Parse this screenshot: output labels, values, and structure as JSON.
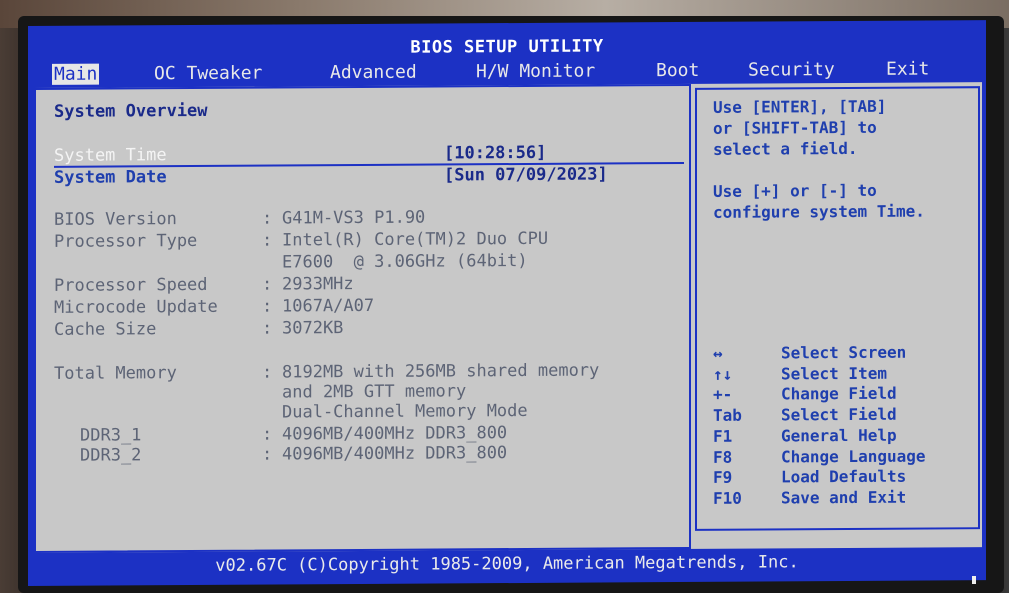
{
  "title": "BIOS SETUP UTILITY",
  "menu": [
    {
      "label": "Main",
      "active": true
    },
    {
      "label": "OC Tweaker",
      "active": false
    },
    {
      "label": "Advanced",
      "active": false
    },
    {
      "label": "H/W Monitor",
      "active": false
    },
    {
      "label": "Boot",
      "active": false
    },
    {
      "label": "Security",
      "active": false
    },
    {
      "label": "Exit",
      "active": false
    }
  ],
  "main": {
    "section_title": "System Overview",
    "system_time_label": "System Time",
    "system_time_value": "[10:28:56]",
    "system_date_label": "System Date",
    "system_date_value": "[Sun 07/09/2023]",
    "info": [
      {
        "label": "BIOS Version",
        "sep": ":",
        "value": "G41M-VS3 P1.90"
      },
      {
        "label": "Processor Type",
        "sep": ":",
        "value": "Intel(R) Core(TM)2 Duo CPU"
      },
      {
        "label": "",
        "sep": "",
        "value": "E7600  @ 3.06GHz (64bit)"
      },
      {
        "label": "Processor Speed",
        "sep": ":",
        "value": "2933MHz"
      },
      {
        "label": "Microcode Update",
        "sep": ":",
        "value": "1067A/A07"
      },
      {
        "label": "Cache Size",
        "sep": ":",
        "value": "3072KB"
      }
    ],
    "memory": [
      {
        "label": "Total Memory",
        "sep": ":",
        "value": "8192MB with 256MB shared memory"
      },
      {
        "label": "",
        "sep": "",
        "value": "and 2MB GTT memory"
      },
      {
        "label": "",
        "sep": "",
        "value": "Dual-Channel Memory Mode"
      },
      {
        "label": "DDR3_1",
        "sep": ":",
        "value": "4096MB/400MHz DDR3_800"
      },
      {
        "label": "DDR3_2",
        "sep": ":",
        "value": "4096MB/400MHz DDR3_800"
      }
    ]
  },
  "help": {
    "lines": [
      "Use [ENTER], [TAB]",
      "or [SHIFT-TAB] to",
      "select a field.",
      "",
      "Use [+] or [-] to",
      "configure system Time."
    ],
    "keys": [
      {
        "key": "↔",
        "action": "Select Screen"
      },
      {
        "key": "↑↓",
        "action": "Select Item"
      },
      {
        "key": "+-",
        "action": "Change Field"
      },
      {
        "key": "Tab",
        "action": "Select Field"
      },
      {
        "key": "F1",
        "action": "General Help"
      },
      {
        "key": "F8",
        "action": "Change Language"
      },
      {
        "key": "F9",
        "action": "Load Defaults"
      },
      {
        "key": "F10",
        "action": "Save and Exit"
      }
    ]
  },
  "footer": "v02.67C (C)Copyright 1985-2009, American Megatrends, Inc."
}
